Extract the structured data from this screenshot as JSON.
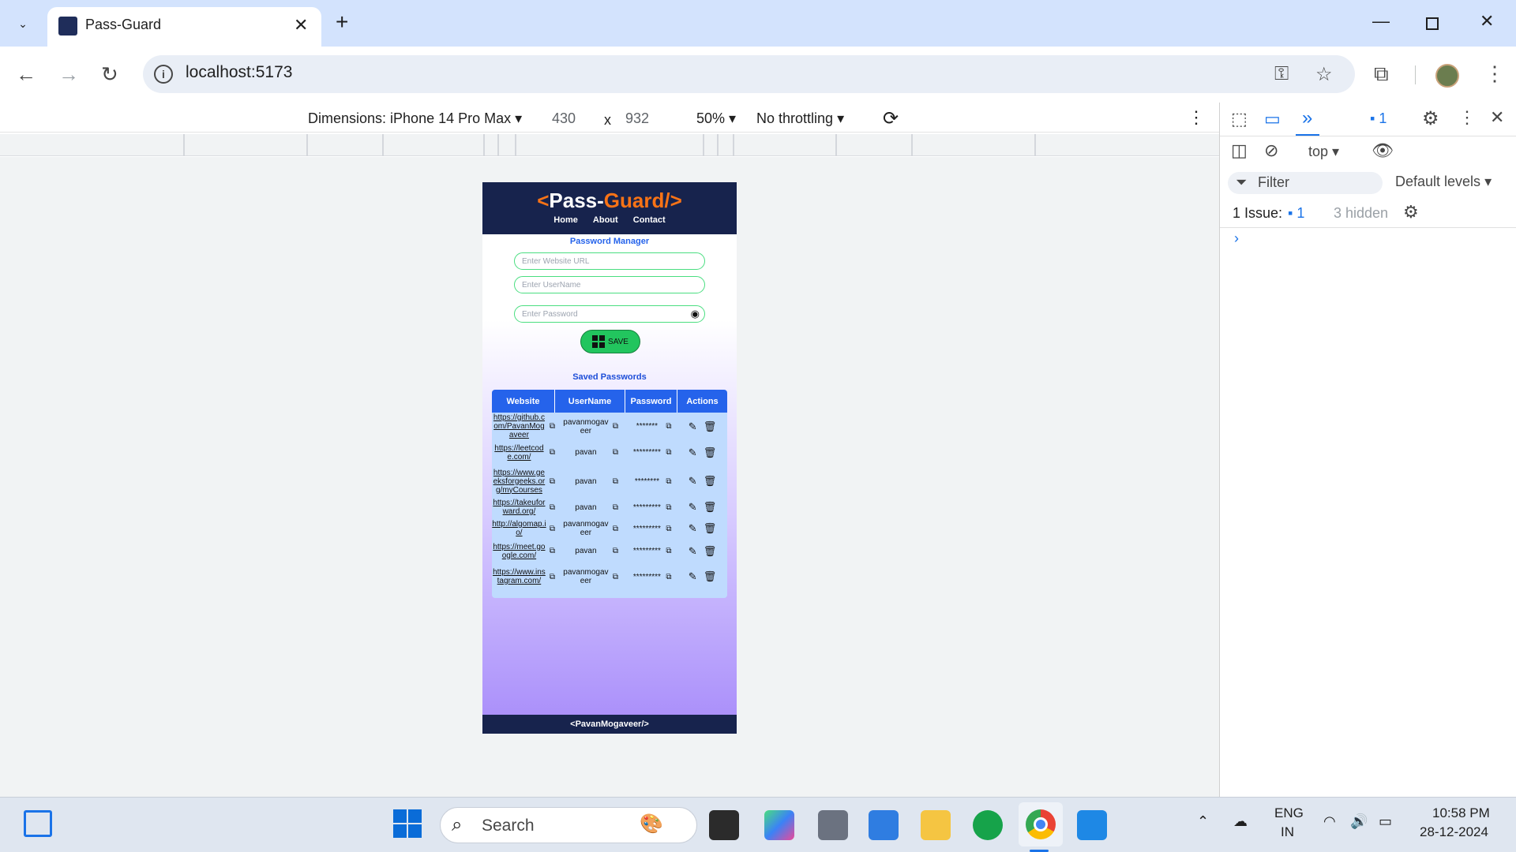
{
  "browser": {
    "tab_title": "Pass-Guard",
    "url": "localhost:5173",
    "new_tab": "+",
    "close_tab": "✕"
  },
  "device_toolbar": {
    "dimensions": "Dimensions: iPhone 14 Pro Max",
    "width": "430",
    "times": "x",
    "height": "932",
    "zoom": "50%",
    "throttling": "No throttling"
  },
  "devtools": {
    "context": "top",
    "filter_placeholder": "Filter",
    "levels": "Default levels",
    "issues_label": "1 Issue:",
    "issues_count": "1",
    "hidden": "3 hidden",
    "badge_count": "1"
  },
  "app": {
    "logo_left": "<",
    "logo_pass": "Pass-",
    "logo_guard": "Guard",
    "logo_right": "/>",
    "nav": [
      "Home",
      "About",
      "Contact"
    ],
    "title": "Password Manager",
    "website_placeholder": "Enter Website URL",
    "username_placeholder": "Enter UserName",
    "password_placeholder": "Enter Password",
    "save_label": "SAVE",
    "saved_title": "Saved Passwords",
    "columns": [
      "Website",
      "UserName",
      "Password",
      "Actions"
    ],
    "rows": [
      {
        "site": "https://github.com/PavanMogaveer",
        "user": "pavanmogaveer",
        "pass": "*******"
      },
      {
        "site": "https://leetcode.com/",
        "user": "pavan",
        "pass": "*********"
      },
      {
        "site": "https://www.geeksforgeeks.org/myCourses",
        "user": "pavan",
        "pass": "********"
      },
      {
        "site": "https://takeuforward.org/",
        "user": "pavan",
        "pass": "*********"
      },
      {
        "site": "http://algomap.io/",
        "user": "pavanmogaveer",
        "pass": "*********"
      },
      {
        "site": "https://meet.google.com/",
        "user": "pavan",
        "pass": "*********"
      },
      {
        "site": "https://www.instagram.com/",
        "user": "pavanmogaveer",
        "pass": "*********"
      }
    ],
    "footer": "<PavanMogaveer/>"
  },
  "taskbar": {
    "search": "Search",
    "lang1": "ENG",
    "lang2": "IN",
    "time": "10:58 PM",
    "date": "28-12-2024"
  }
}
